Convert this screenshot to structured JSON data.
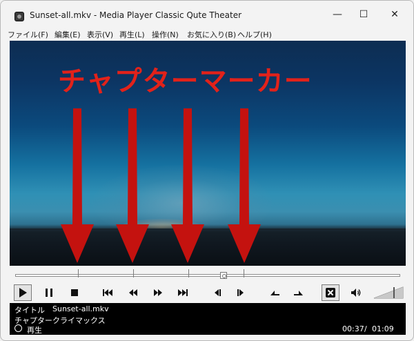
{
  "window": {
    "title": "Sunset-all.mkv - Media Player Classic Qute Theater",
    "controls": {
      "minimize": "—",
      "maximize": "☐",
      "close": "✕"
    }
  },
  "menu": {
    "items": [
      "ファイル(F)",
      "編集(E)",
      "表示(V)",
      "再生(L)",
      "操作(N)",
      "お気に入り(B)",
      "ヘルプ(H)"
    ]
  },
  "video": {
    "overlay_caption": "チャプターマーカー",
    "colors": {
      "caption": "#e2221a",
      "arrow": "#c4120f"
    }
  },
  "seekbar": {
    "position_fraction": 0.555,
    "chapter_marks_fraction": [
      0.17,
      0.313,
      0.457,
      0.6
    ]
  },
  "toolbar": {
    "buttons": [
      {
        "name": "play-button",
        "icon": "play-icon",
        "pressed": true
      },
      {
        "name": "pause-button",
        "icon": "pause-icon"
      },
      {
        "name": "stop-button",
        "icon": "stop-icon"
      },
      {
        "name": "previous-button",
        "icon": "skip-back-icon"
      },
      {
        "name": "rewind-button",
        "icon": "rewind-icon"
      },
      {
        "name": "fast-forward-button",
        "icon": "fast-forward-icon"
      },
      {
        "name": "next-button",
        "icon": "skip-forward-icon"
      },
      {
        "name": "frame-back-button",
        "icon": "frame-back-icon"
      },
      {
        "name": "frame-forward-button",
        "icon": "frame-forward-icon"
      },
      {
        "name": "speed-down-button",
        "icon": "speed-down-icon"
      },
      {
        "name": "speed-up-button",
        "icon": "speed-up-icon"
      },
      {
        "name": "audio-toggle-button",
        "icon": "audio-mute-toggle-icon",
        "pressed": true
      },
      {
        "name": "volume-icon-button",
        "icon": "speaker-icon"
      }
    ],
    "volume_level_fraction": 1.0
  },
  "status": {
    "title_label": "タイトル",
    "title_value": "Sunset-all.mkv",
    "chapter_label": "チャプター",
    "chapter_value": "クライマックス",
    "state_text": "再生",
    "current_time": "00:37",
    "separator": "/",
    "total_time": "01:09"
  }
}
